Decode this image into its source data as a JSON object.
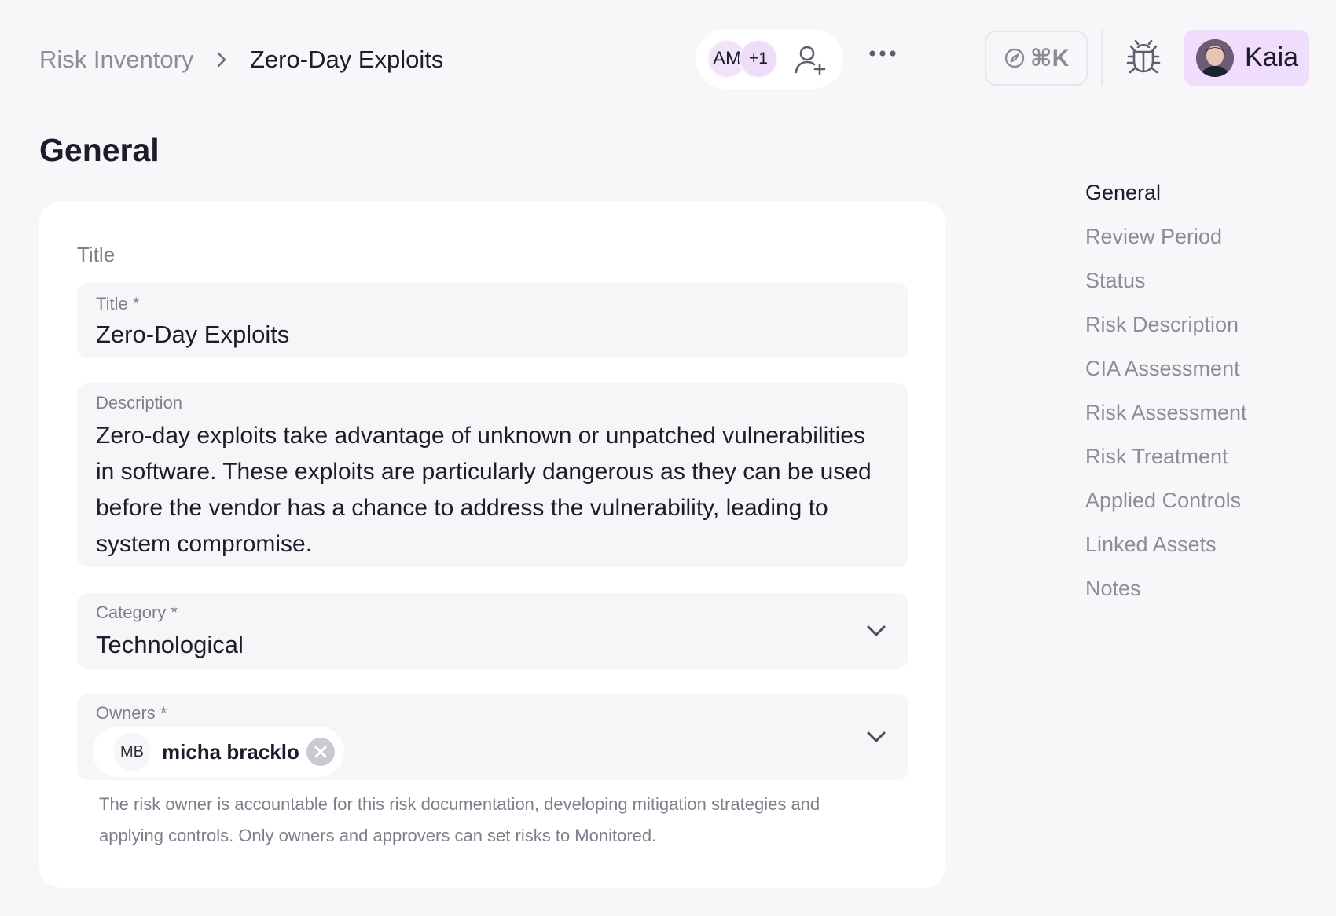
{
  "breadcrumb": {
    "root": "Risk Inventory",
    "current": "Zero-Day Exploits"
  },
  "collaborators": {
    "initials": "AM",
    "extra": "+1"
  },
  "command": {
    "shortcut": "⌘K"
  },
  "user": {
    "name": "Kaia"
  },
  "page": {
    "title": "General"
  },
  "form": {
    "section": "Title",
    "title_field": {
      "label": "Title *",
      "value": "Zero-Day Exploits"
    },
    "description_field": {
      "label": "Description",
      "value": "Zero-day exploits take advantage of unknown or unpatched vulnerabilities in software. These exploits are particularly dangerous as they can be used before the vendor has a chance to address the vulnerability, leading to system compromise."
    },
    "category_field": {
      "label": "Category *",
      "value": "Technological"
    },
    "owners_field": {
      "label": "Owners *",
      "owner": {
        "initials": "MB",
        "name": "micha bracklo"
      }
    },
    "owners_hint": "The risk owner is accountable for this risk documentation, developing mitigation strategies and applying controls. Only owners and approvers can set risks to Monitored."
  },
  "toc": [
    {
      "label": "General"
    },
    {
      "label": "Review Period"
    },
    {
      "label": "Status"
    },
    {
      "label": "Risk Description"
    },
    {
      "label": "CIA Assessment"
    },
    {
      "label": "Risk Assessment"
    },
    {
      "label": "Risk Treatment"
    },
    {
      "label": "Applied Controls"
    },
    {
      "label": "Linked Assets"
    },
    {
      "label": "Notes"
    }
  ],
  "icons": [
    "chevron-right-icon",
    "add-user-icon",
    "more-icon",
    "compass-icon",
    "bug-icon",
    "chevron-down-icon",
    "close-icon"
  ]
}
